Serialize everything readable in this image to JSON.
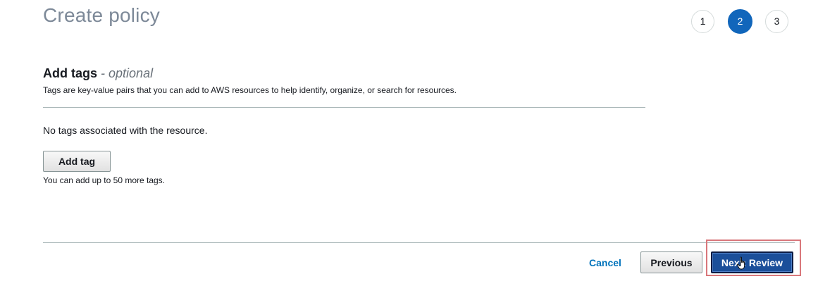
{
  "header": {
    "title": "Create policy"
  },
  "steps": [
    {
      "label": "1",
      "active": false
    },
    {
      "label": "2",
      "active": true
    },
    {
      "label": "3",
      "active": false
    }
  ],
  "tags_section": {
    "heading": "Add tags",
    "optional": "- optional",
    "description": "Tags are key-value pairs that you can add to AWS resources to help identify, organize, or search for resources.",
    "empty_message": "No tags associated with the resource.",
    "add_button": "Add tag",
    "limit_text": "You can add up to 50 more tags."
  },
  "footer": {
    "cancel": "Cancel",
    "previous": "Previous",
    "next": "Next: Review"
  },
  "colors": {
    "active_step": "#1166bb",
    "primary_button": "#1b4f9a",
    "link": "#0073bb",
    "highlight": "#d9777b"
  }
}
